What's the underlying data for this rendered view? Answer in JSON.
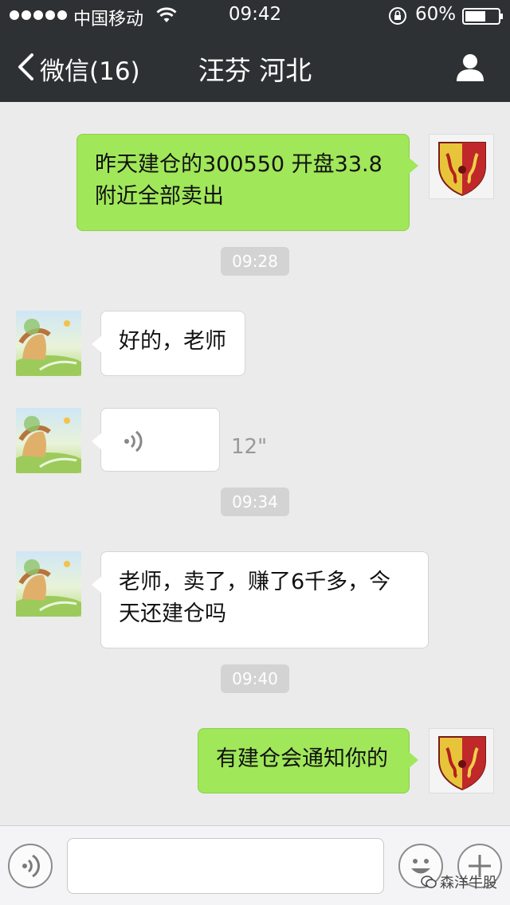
{
  "status": {
    "carrier": "中国移动",
    "time": "09:42",
    "battery": "60%"
  },
  "nav": {
    "back_label": "微信(16)",
    "title": "汪芬 河北"
  },
  "messages": [
    {
      "side": "right",
      "type": "text",
      "line1": "昨天建仓的300550 开盘33.8",
      "line2": "附近全部卖出"
    },
    {
      "type": "timestamp",
      "text": "09:28"
    },
    {
      "side": "left",
      "type": "text",
      "line1": "好的，老师"
    },
    {
      "side": "left",
      "type": "voice",
      "duration": "12\""
    },
    {
      "type": "timestamp",
      "text": "09:34"
    },
    {
      "side": "left",
      "type": "text",
      "line1": "老师，卖了，赚了6千多，今",
      "line2": "天还建仓吗"
    },
    {
      "type": "timestamp",
      "text": "09:40"
    },
    {
      "side": "right",
      "type": "text",
      "line1": "有建仓会通知你的"
    }
  ],
  "watermark": "森洋牛股",
  "colors": {
    "topbar": "#2e3133",
    "background": "#ebebeb",
    "bubble_sent": "#a0e75a",
    "bubble_received": "#ffffff",
    "timestamp_bg": "#d3d3d3"
  }
}
